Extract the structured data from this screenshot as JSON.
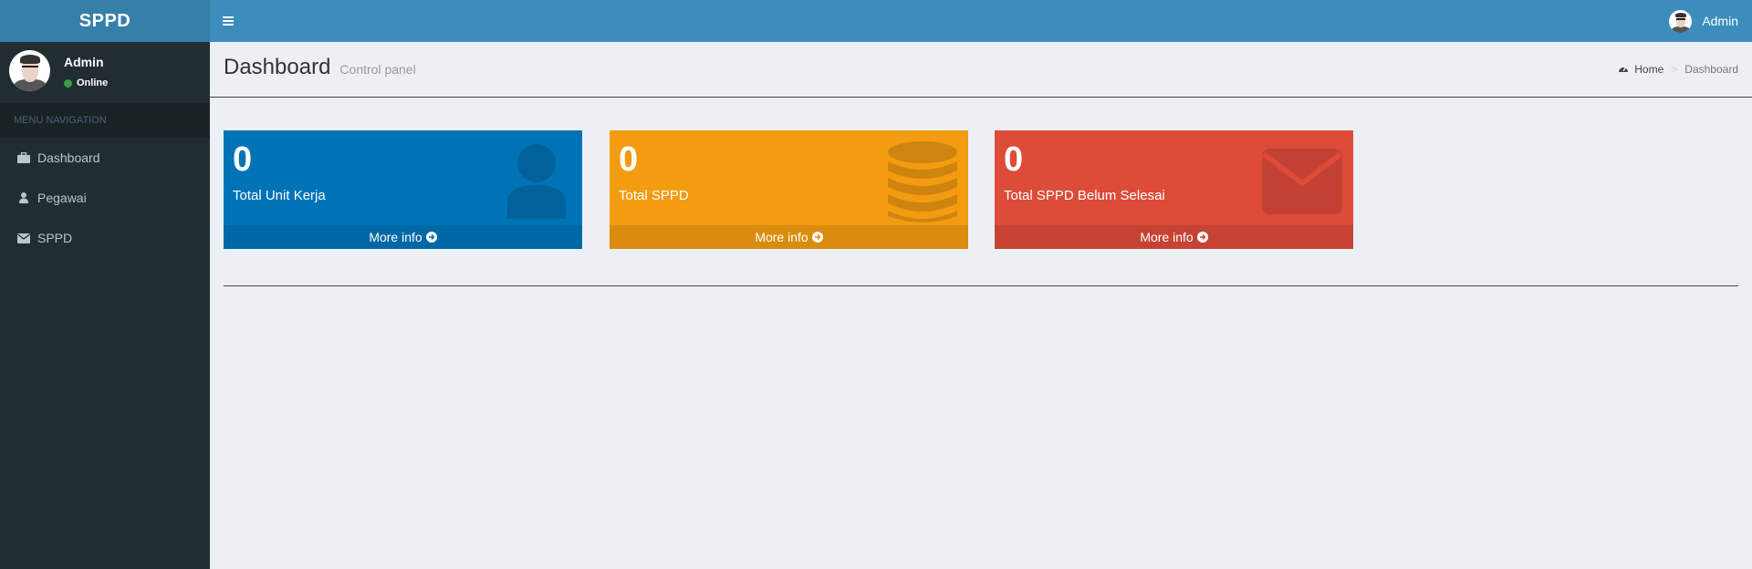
{
  "brand": {
    "logo_text": "SPPD"
  },
  "header": {
    "user_name": "Admin"
  },
  "sidebar": {
    "user": {
      "name": "Admin",
      "status": "Online"
    },
    "menu_header": "MENU NAVIGATION",
    "items": [
      {
        "label": "Dashboard",
        "icon": "briefcase-icon"
      },
      {
        "label": "Pegawai",
        "icon": "user-icon"
      },
      {
        "label": "SPPD",
        "icon": "envelope-icon"
      }
    ]
  },
  "content": {
    "title": "Dashboard",
    "subtitle": "Control panel",
    "breadcrumb": {
      "home": "Home",
      "separator": ">",
      "current": "Dashboard"
    }
  },
  "stats": [
    {
      "value": "0",
      "label": "Total Unit Kerja",
      "footer": "More info",
      "color": "#0073b7",
      "icon": "user-icon"
    },
    {
      "value": "0",
      "label": "Total SPPD",
      "footer": "More info",
      "color": "#f39c12",
      "icon": "database-icon"
    },
    {
      "value": "0",
      "label": "Total SPPD Belum Selesai",
      "footer": "More info",
      "color": "#dd4b39",
      "icon": "envelope-icon"
    }
  ],
  "colors": {
    "header": "#3c8dbc",
    "logo": "#367fa9",
    "sidebar": "#222d32",
    "content_bg": "#ecf0f5"
  }
}
